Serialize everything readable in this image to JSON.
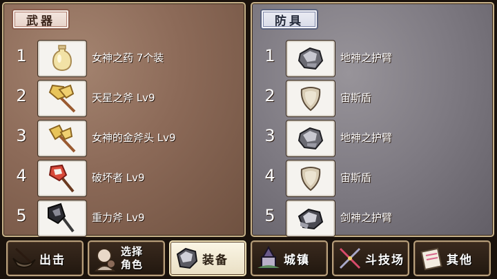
{
  "weapons": {
    "title": "武器",
    "items": [
      {
        "num": "1",
        "name": "女神之药 7个装",
        "icon": "potion-bottle-icon"
      },
      {
        "num": "2",
        "name": "天星之斧 Lv9",
        "icon": "golden-axe-icon"
      },
      {
        "num": "3",
        "name": "女神的金斧头 Lv9",
        "icon": "golden-axe-icon"
      },
      {
        "num": "4",
        "name": "破坏者 Lv9",
        "icon": "red-axe-icon"
      },
      {
        "num": "5",
        "name": "重力斧 Lv9",
        "icon": "dark-axe-icon"
      }
    ]
  },
  "armor": {
    "title": "防具",
    "items": [
      {
        "num": "1",
        "name": "地神之护臂",
        "icon": "gauntlet-icon"
      },
      {
        "num": "2",
        "name": "宙斯盾",
        "icon": "shield-icon"
      },
      {
        "num": "3",
        "name": "地神之护臂",
        "icon": "gauntlet-icon"
      },
      {
        "num": "4",
        "name": "宙斯盾",
        "icon": "shield-icon"
      },
      {
        "num": "5",
        "name": "剑神之护臂",
        "icon": "gauntlet-icon"
      }
    ]
  },
  "nav": {
    "sortie": "出击",
    "character_line1": "选择",
    "character_line2": "角色",
    "equipment": "装备",
    "town": "城镇",
    "arena": "斗技场",
    "other": "其他",
    "active": "equipment"
  }
}
